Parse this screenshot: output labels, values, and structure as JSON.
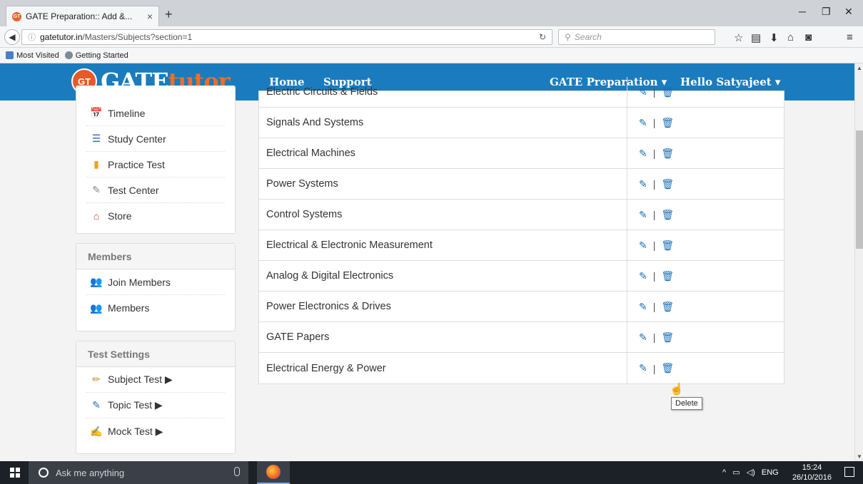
{
  "browser": {
    "tab_title": "GATE Preparation:: Add &...",
    "tab_close": "×",
    "new_tab": "+",
    "url_host": "gatetutor.in",
    "url_path": "/Masters/Subjects?section=1",
    "search_placeholder": "Search",
    "bookmarks": [
      "Most Visited",
      "Getting Started"
    ]
  },
  "header": {
    "logo_badge": "GT",
    "logo_gate": "GATE",
    "logo_tutor": "tutor",
    "nav": [
      "Home",
      "Support"
    ],
    "gate_menu": "GATE Preparation ▾",
    "user_menu": "Hello Satyajeet ▾"
  },
  "sidebar": {
    "main_items": [
      {
        "label": "Timeline",
        "icon": "timeline-icon"
      },
      {
        "label": "Study Center",
        "icon": "books-icon"
      },
      {
        "label": "Practice Test",
        "icon": "clipboard-icon"
      },
      {
        "label": "Test Center",
        "icon": "test-icon"
      },
      {
        "label": "Store",
        "icon": "store-icon"
      }
    ],
    "members_title": "Members",
    "members_items": [
      {
        "label": "Join Members",
        "icon": "join-members-icon"
      },
      {
        "label": "Members",
        "icon": "members-icon"
      }
    ],
    "settings_title": "Test Settings",
    "settings_items": [
      {
        "label": "Subject Test ▶",
        "icon": "pencil-icon"
      },
      {
        "label": "Topic Test ▶",
        "icon": "edit-icon"
      },
      {
        "label": "Mock Test ▶",
        "icon": "mock-icon"
      }
    ]
  },
  "subjects": [
    "Electric Circuits & Fields",
    "Signals And Systems",
    "Electrical Machines",
    "Power Systems",
    "Control Systems",
    "Electrical & Electronic Measurement",
    "Analog & Digital Electronics",
    "Power Electronics & Drives",
    "GATE Papers",
    "Electrical Energy & Power"
  ],
  "actions": {
    "separator": "|"
  },
  "tooltip": "Delete",
  "taskbar": {
    "search_placeholder": "Ask me anything",
    "language": "ENG",
    "time": "15:24",
    "date": "26/10/2016"
  }
}
